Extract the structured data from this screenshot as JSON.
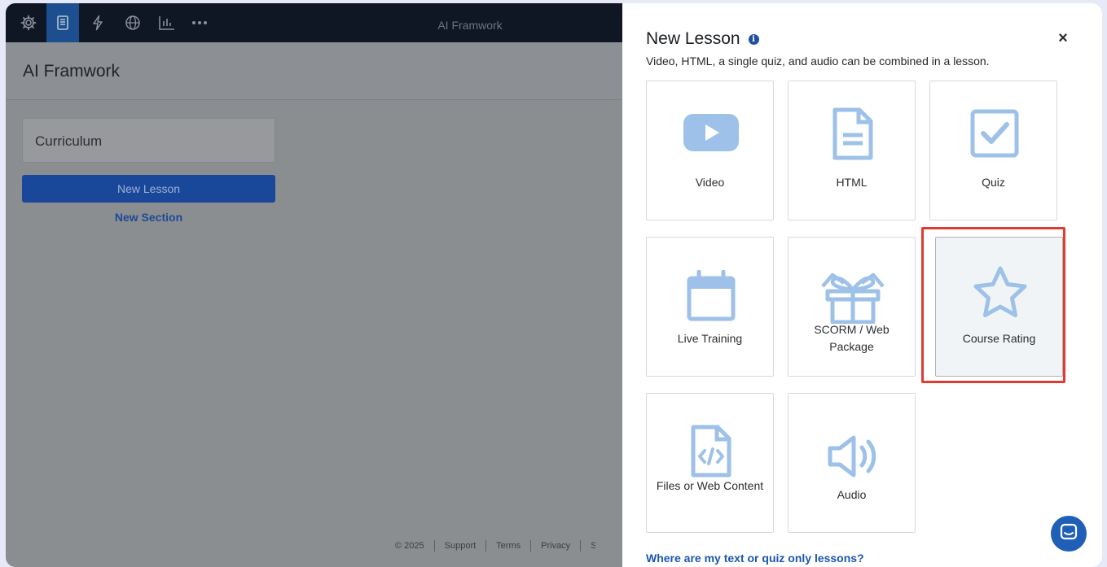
{
  "app": {
    "title": "AI Framwork",
    "toolbar_icons": [
      "gear-icon",
      "book-icon",
      "bolt-icon",
      "globe-icon",
      "bar-chart-icon",
      "more-icon"
    ],
    "active_toolbar_icon": "book-icon"
  },
  "course": {
    "title": "AI Framwork",
    "curriculum_label": "Curriculum",
    "new_lesson_label": "New Lesson",
    "new_section_label": "New Section"
  },
  "footer": {
    "items": [
      "© 2025",
      "Support",
      "Terms",
      "Privacy",
      "S"
    ]
  },
  "modal": {
    "title": "New Lesson",
    "info_glyph": "i",
    "close_glyph": "×",
    "subtitle": "Video, HTML, a single quiz, and audio can be combined in a lesson.",
    "cards": [
      {
        "label": "Video",
        "icon": "video-icon",
        "selected": false
      },
      {
        "label": "HTML",
        "icon": "document-icon",
        "selected": false
      },
      {
        "label": "Quiz",
        "icon": "checkbox-icon",
        "selected": false
      },
      {
        "label": "Live Training",
        "icon": "calendar-icon",
        "selected": false
      },
      {
        "label": "SCORM / Web Package",
        "icon": "package-icon",
        "selected": false
      },
      {
        "label": "Course Rating",
        "icon": "star-icon",
        "selected": true
      },
      {
        "label": "Files or Web Content",
        "icon": "code-file-icon",
        "selected": false
      },
      {
        "label": "Audio",
        "icon": "speaker-icon",
        "selected": false
      }
    ],
    "help_link": "Where are my text or quiz only lessons?"
  },
  "colors": {
    "accent": "#1d4fa2",
    "icon_blue": "#9dc1e8",
    "highlight": "#df3b2e",
    "overlay": "#8b8e91"
  }
}
